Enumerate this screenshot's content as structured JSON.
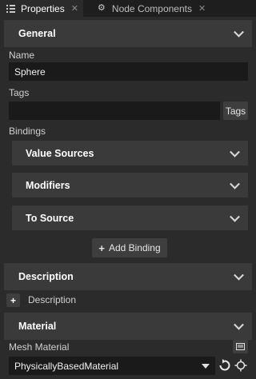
{
  "tabs": [
    {
      "label": "Properties",
      "icon": "list-icon",
      "active": true
    },
    {
      "label": "Node Components",
      "icon": "nodes-icon",
      "active": false
    }
  ],
  "general": {
    "header": "General",
    "name_label": "Name",
    "name_value": "Sphere",
    "tags_label": "Tags",
    "tags_value": "",
    "tags_button": "Tags",
    "bindings_label": "Bindings",
    "sections": [
      "Value Sources",
      "Modifiers",
      "To Source"
    ],
    "add_binding_button": "Add Binding"
  },
  "description": {
    "header": "Description",
    "add_label": "Description"
  },
  "material": {
    "header": "Material",
    "mesh_material_label": "Mesh Material",
    "mesh_material_value": "PhysicallyBasedMaterial"
  },
  "colors": {
    "background": "#2b2b2b",
    "header_bg": "#3a3a3a",
    "field_bg": "#1a1a1a",
    "tabbar_bg": "#1e1e1e"
  }
}
